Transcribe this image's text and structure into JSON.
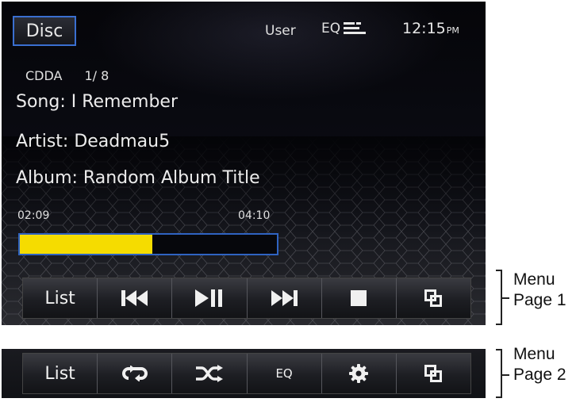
{
  "header": {
    "source_button": "Disc",
    "user_label": "User",
    "eq_label": "EQ",
    "clock_time": "12:15",
    "clock_ampm": "PM"
  },
  "track": {
    "format": "CDDA",
    "position": "1/ 8",
    "song": "Song: I Remember",
    "artist": "Artist: Deadmau5",
    "album": "Album: Random Album Title",
    "elapsed": "02:09",
    "total": "04:10",
    "progress_fraction": 0.515
  },
  "menu_page_1": {
    "list_label": "List",
    "icons": [
      "previous-track-icon",
      "play-pause-icon",
      "next-track-icon",
      "stop-icon",
      "page-switch-icon"
    ]
  },
  "menu_page_2": {
    "list_label": "List",
    "eq_label": "EQ",
    "icons": [
      "repeat-icon",
      "shuffle-icon",
      "settings-gear-icon",
      "page-switch-icon"
    ]
  },
  "captions": {
    "page1_line1": "Menu",
    "page1_line2": "Page 1",
    "page2_line1": "Menu",
    "page2_line2": "Page 2"
  },
  "colors": {
    "progress_fill": "#f5dc00",
    "accent_border": "#2f63c2",
    "screen_bg": "#0a0b12"
  }
}
